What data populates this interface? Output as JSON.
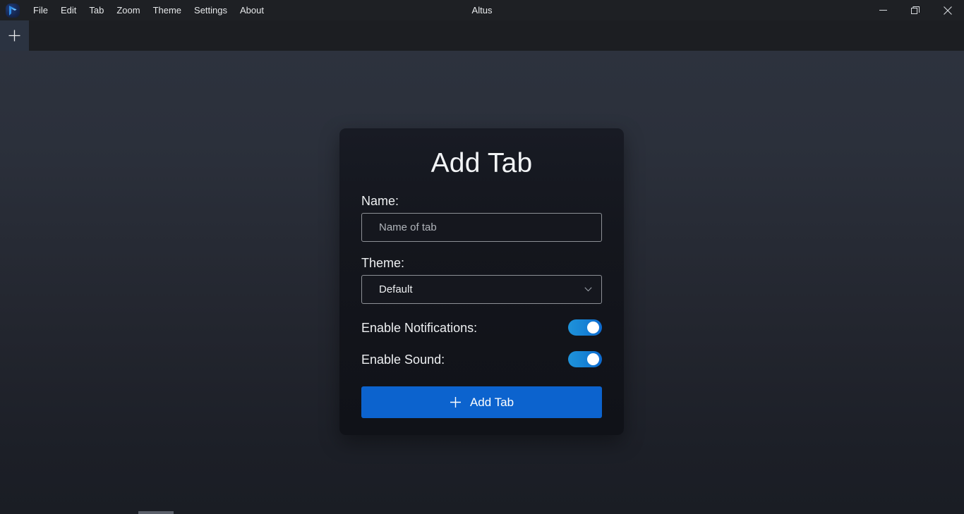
{
  "window": {
    "title": "Altus",
    "app_icon": "altus-logo-icon",
    "controls": [
      {
        "name": "minimize",
        "icon": "minimize-icon"
      },
      {
        "name": "restore",
        "icon": "restore-icon"
      },
      {
        "name": "close",
        "icon": "close-icon"
      }
    ]
  },
  "menubar": {
    "items": [
      {
        "label": "File"
      },
      {
        "label": "Edit"
      },
      {
        "label": "Tab"
      },
      {
        "label": "Zoom"
      },
      {
        "label": "Theme"
      },
      {
        "label": "Settings"
      },
      {
        "label": "About"
      }
    ]
  },
  "tabbar": {
    "add_tab_icon": "plus-icon",
    "tabs": []
  },
  "dialog": {
    "title": "Add Tab",
    "name_field": {
      "label": "Name:",
      "value": "",
      "placeholder": "Name of tab"
    },
    "theme_field": {
      "label": "Theme:",
      "selected": "Default",
      "chevron_icon": "chevron-down-icon",
      "options": [
        "Default"
      ]
    },
    "notifications_toggle": {
      "label": "Enable Notifications:",
      "state": "on"
    },
    "sound_toggle": {
      "label": "Enable Sound:",
      "state": "on"
    },
    "submit_button": {
      "label": "Add Tab",
      "icon": "plus-icon"
    }
  },
  "colors": {
    "accent_blue": "#0c63ce",
    "toggle_on_left": "#1f93da",
    "toggle_on_right": "#0d6ad0",
    "titlebar_bg": "#1e2024",
    "tabbar_bg": "#1c1e22",
    "dialog_bg": "#15171e",
    "page_bg_top": "#2e333f",
    "page_bg_bottom": "#1a1d24"
  }
}
